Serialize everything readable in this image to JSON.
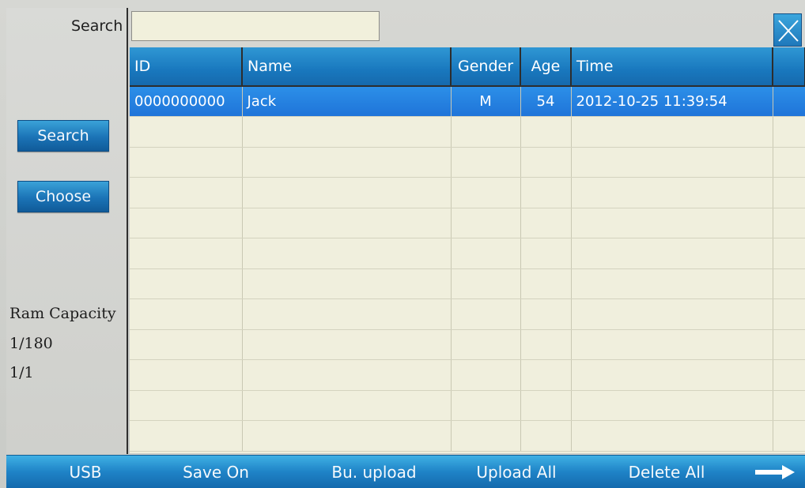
{
  "left_panel": {
    "search_label": "Search",
    "search_button": "Search",
    "choose_button": "Choose",
    "ram_capacity_label": "Ram Capacity",
    "ram_ratio": "1/180",
    "page_indicator": "1/1"
  },
  "search": {
    "value": ""
  },
  "table": {
    "headers": [
      "ID",
      "Name",
      "Gender",
      "Age",
      "Time",
      ""
    ],
    "rows": [
      {
        "id": "0000000000",
        "name": "Jack",
        "gender": "M",
        "age": "54",
        "time": "2012-10-25 11:39:54",
        "extra": ""
      }
    ]
  },
  "bottom_bar": {
    "usb": "USB",
    "save_on": "Save On",
    "bu_upload": "Bu. upload",
    "upload_all": "Upload All",
    "delete_all": "Delete All",
    "next_icon": "right-arrow-icon"
  },
  "colors": {
    "accent": "#1b73b6",
    "selected_row": "#1f74d9",
    "grid_bg": "#f0efdd"
  }
}
